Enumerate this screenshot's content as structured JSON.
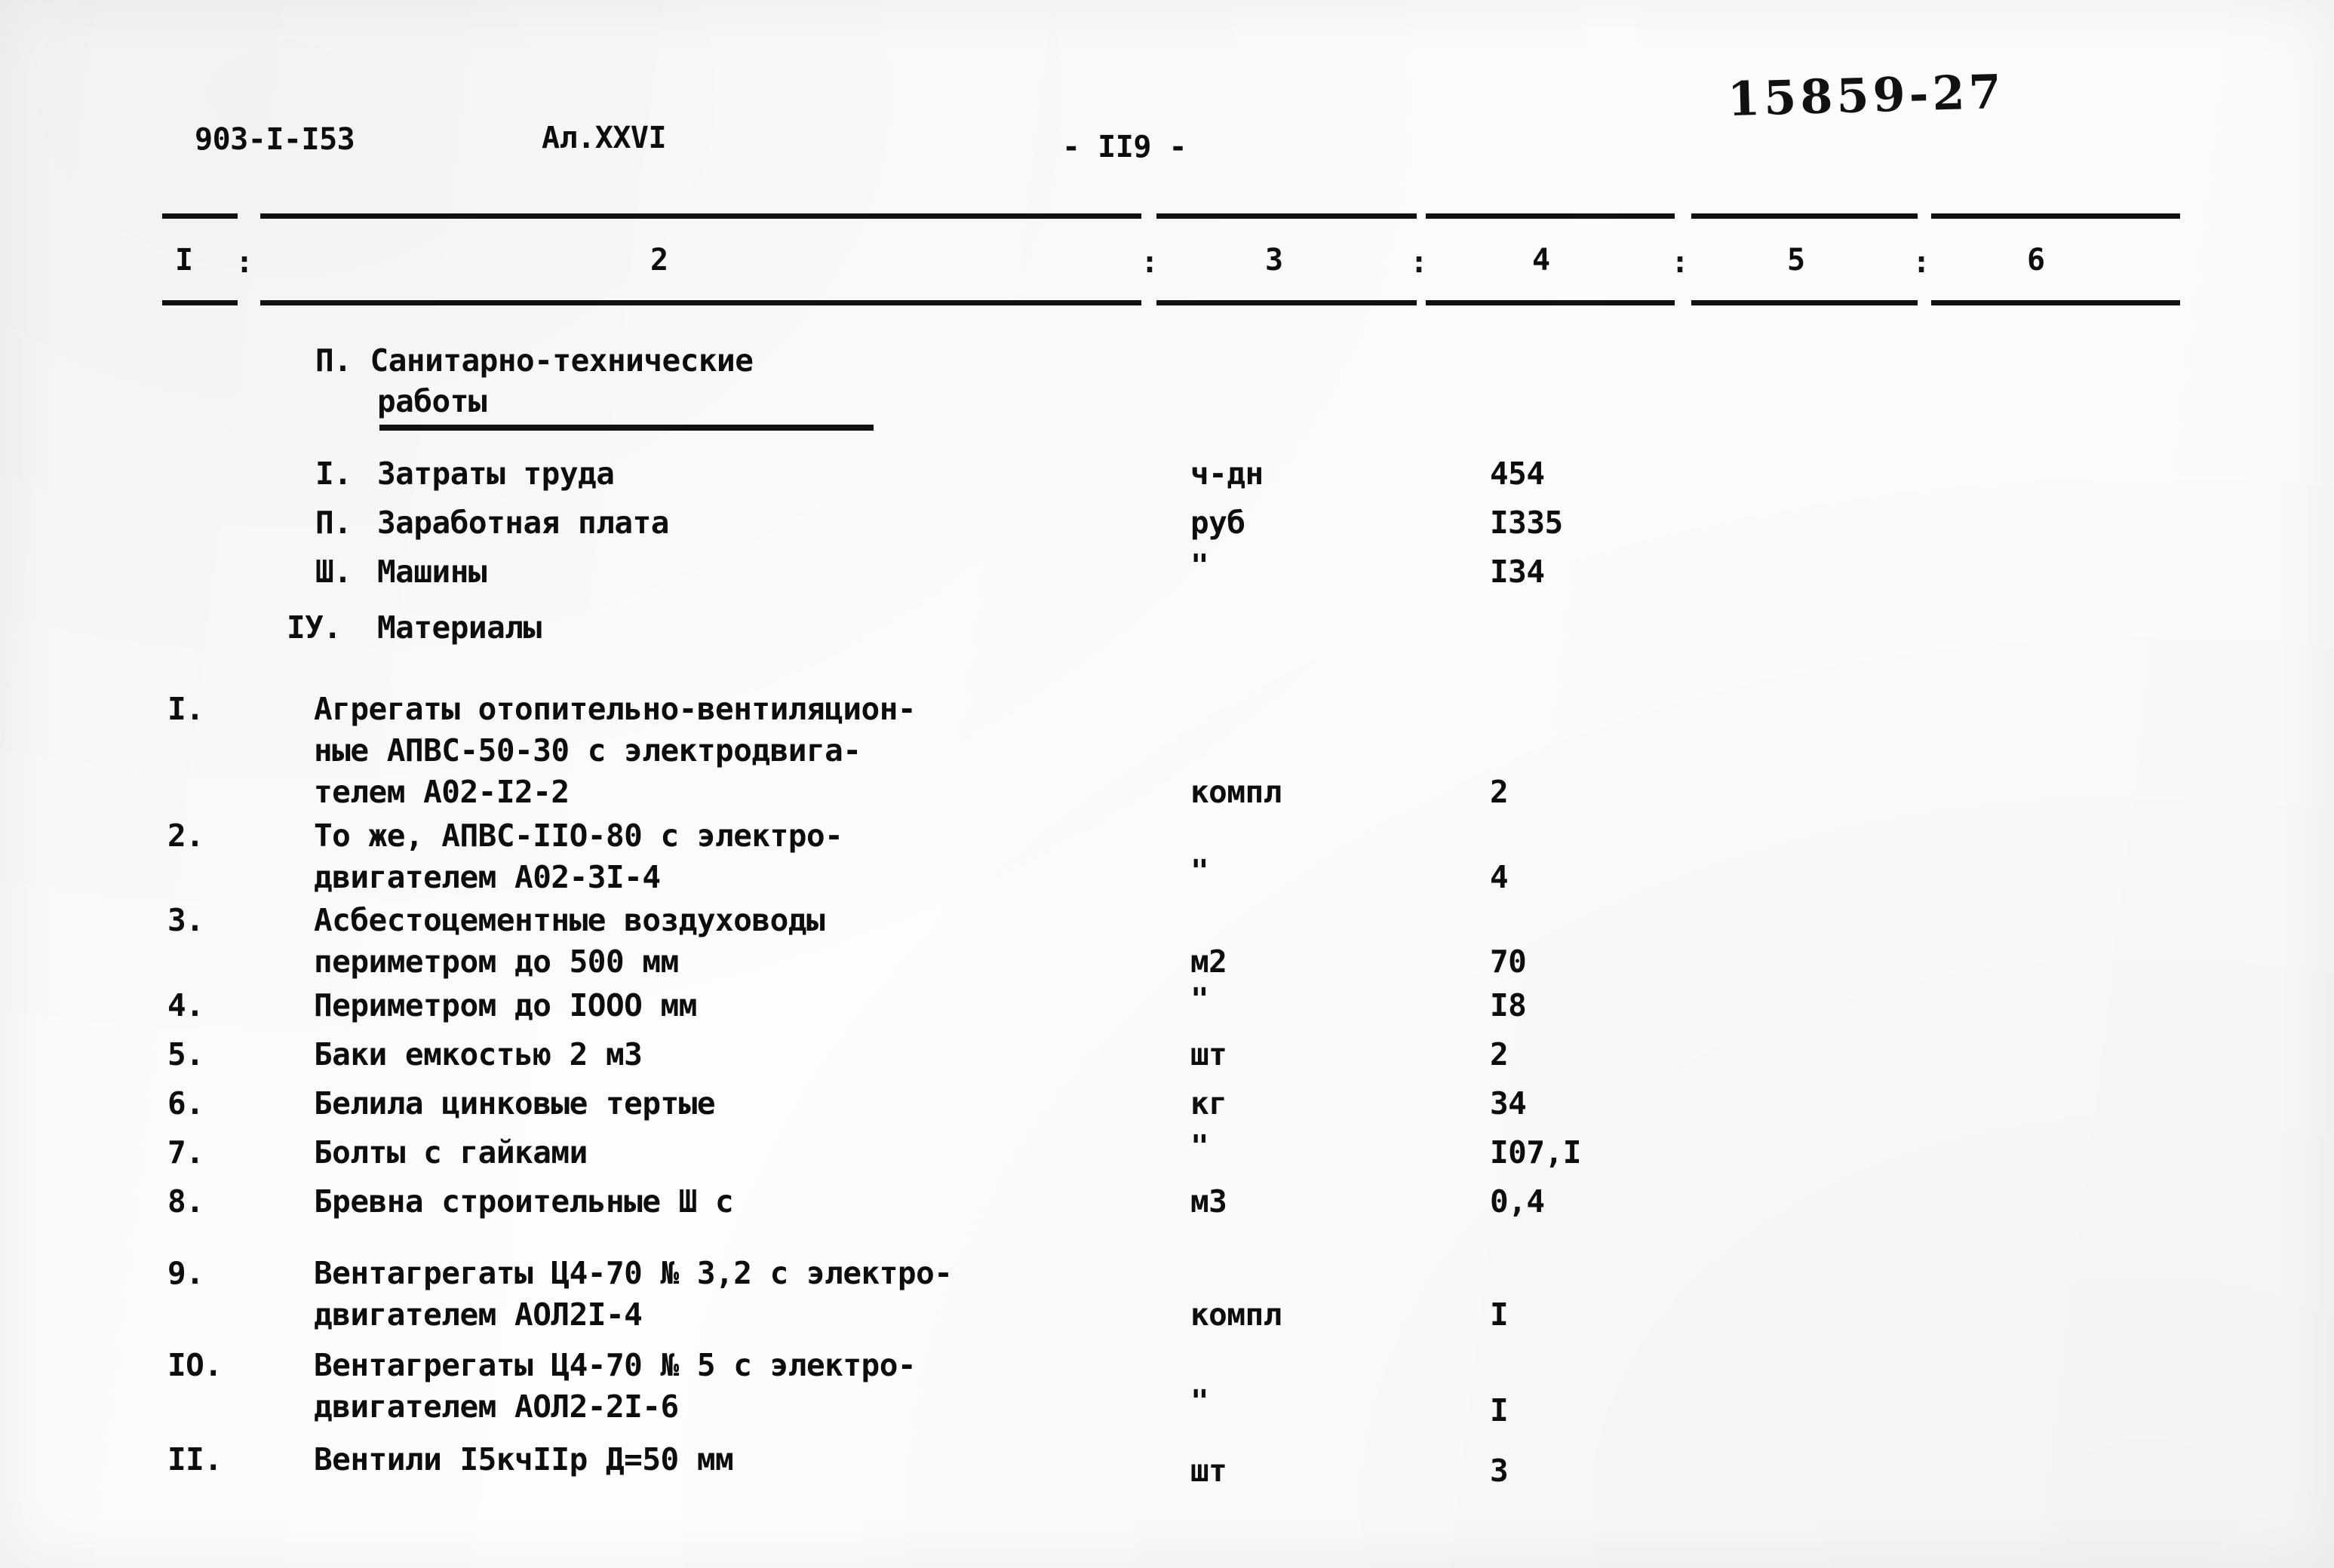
{
  "header": {
    "doc_number": "903-I-I53",
    "album": "Ал.XXVI",
    "page_marker": "- II9 -",
    "handwritten_note": "15859-27"
  },
  "table": {
    "column_headers": [
      "I",
      "2",
      "3",
      "4",
      "5",
      "6"
    ],
    "separator": ":",
    "section_title_line1": "П. Санитарно-технические",
    "section_title_line2": "работы",
    "summary_rows": [
      {
        "no": "I.",
        "name": "Затраты труда",
        "unit": "ч-дн",
        "value": "454"
      },
      {
        "no": "П.",
        "name": "Заработная плата",
        "unit": "руб",
        "value": "I335"
      },
      {
        "no": "Ш.",
        "name": "Машины",
        "unit": "\"",
        "value": "I34"
      },
      {
        "no": "IУ.",
        "name": "Материалы",
        "unit": "",
        "value": ""
      }
    ],
    "material_rows": [
      {
        "no": "I.",
        "name_line1": "Агрегаты отопительно-вентиляцион-",
        "name_line2": "ные АПВС-50-30 с электродвига-",
        "name_line3": "телем А02-I2-2",
        "unit": "компл",
        "value": "2"
      },
      {
        "no": "2.",
        "name_line1": "То же, АПВС-IIО-80 с электро-",
        "name_line2": "двигателем А02-3I-4",
        "name_line3": "",
        "unit": "\"",
        "value": "4"
      },
      {
        "no": "3.",
        "name_line1": "Асбестоцементные воздуховоды",
        "name_line2": "периметром до 500 мм",
        "name_line3": "",
        "unit": "м2",
        "value": "70"
      },
      {
        "no": "4.",
        "name_line1": "Периметром до IООО мм",
        "name_line2": "",
        "name_line3": "",
        "unit": "\"",
        "value": "I8"
      },
      {
        "no": "5.",
        "name_line1": "Баки емкостью 2 м3",
        "name_line2": "",
        "name_line3": "",
        "unit": "шт",
        "value": "2"
      },
      {
        "no": "6.",
        "name_line1": "Белила цинковые тертые",
        "name_line2": "",
        "name_line3": "",
        "unit": "кг",
        "value": "34"
      },
      {
        "no": "7.",
        "name_line1": "Болты с гайками",
        "name_line2": "",
        "name_line3": "",
        "unit": "\"",
        "value": "I07,I"
      },
      {
        "no": "8.",
        "name_line1": "Бревна строительные Ш с",
        "name_line2": "",
        "name_line3": "",
        "unit": "м3",
        "value": "0,4"
      },
      {
        "no": "9.",
        "name_line1": "Вентагрегаты Ц4-70 № 3,2 с электро-",
        "name_line2": "двигателем АОЛ2I-4",
        "name_line3": "",
        "unit": "компл",
        "value": "I"
      },
      {
        "no": "IО.",
        "name_line1": "Вентагрегаты Ц4-70 № 5 с электро-",
        "name_line2": "двигателем АОЛ2-2I-6",
        "name_line3": "",
        "unit": "\"",
        "value": "I"
      },
      {
        "no": "II.",
        "name_line1": "Вентили I5кчIIр Д=50 мм",
        "name_line2": "",
        "name_line3": "",
        "unit": "шт",
        "value": "3"
      }
    ]
  }
}
